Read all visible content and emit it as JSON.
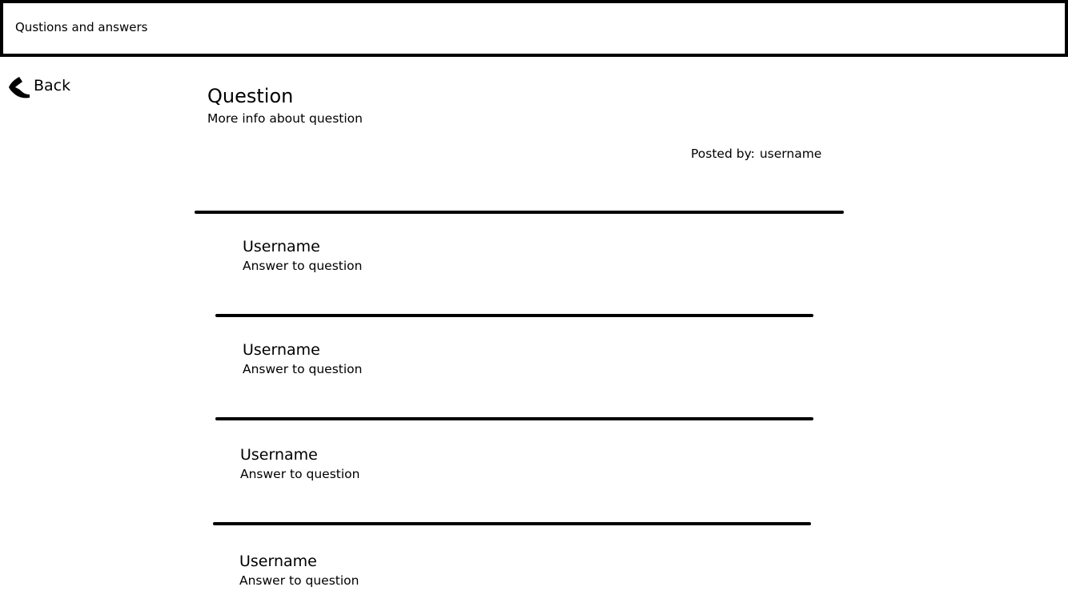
{
  "header": {
    "title": "Qustions and answers"
  },
  "nav": {
    "back_label": "Back",
    "back_icon": "back-arrow-icon"
  },
  "question": {
    "title": "Question",
    "info": "More info about question",
    "posted_by_label": "Posted by:",
    "posted_by_user": "username"
  },
  "answers": [
    {
      "username": "Username",
      "text": "Answer to question"
    },
    {
      "username": "Username",
      "text": "Answer to question"
    },
    {
      "username": "Username",
      "text": "Answer to question"
    },
    {
      "username": "Username",
      "text": "Answer to question"
    }
  ]
}
